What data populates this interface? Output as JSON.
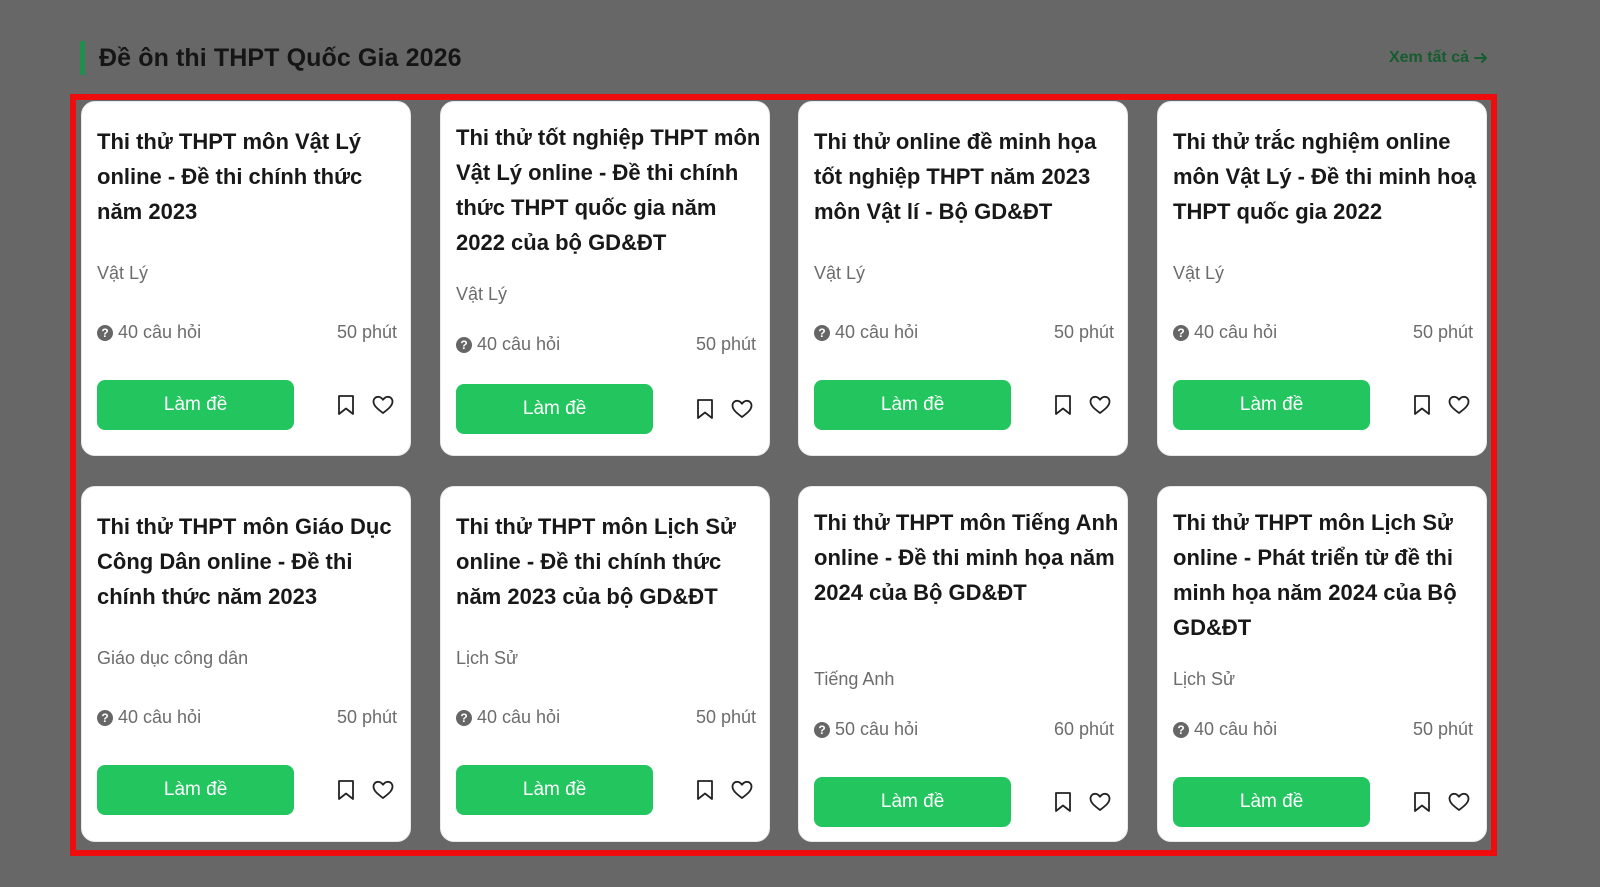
{
  "section": {
    "title": "Đề ôn thi THPT Quốc Gia 2026",
    "view_all": "Xem tất cả",
    "view_all_icon": "arrow-right-icon"
  },
  "colors": {
    "page_background": "#676767",
    "accent": "#1f8f4e",
    "button": "#22c55e",
    "highlight_frame": "#ee0c0c"
  },
  "cards": [
    {
      "title": "Thi thử THPT môn Vật Lý online - Đề thi chính thức năm 2023",
      "subject": "Vật Lý",
      "questions": "40 câu hỏi",
      "duration": "50 phút",
      "button": "Làm đề"
    },
    {
      "title": "Thi thử tốt nghiệp THPT môn Vật Lý online - Đề thi chính thức THPT quốc gia năm 2022 của bộ GD&ĐT",
      "subject": "Vật Lý",
      "questions": "40 câu hỏi",
      "duration": "50 phút",
      "button": "Làm đề"
    },
    {
      "title": "Thi thử online đề minh họa tốt nghiệp THPT năm 2023 môn Vật lí - Bộ GD&ĐT",
      "subject": "Vật Lý",
      "questions": "40 câu hỏi",
      "duration": "50 phút",
      "button": "Làm đề"
    },
    {
      "title": "Thi thử trắc nghiệm online môn Vật Lý - Đề thi minh hoạ THPT quốc gia 2022",
      "subject": "Vật Lý",
      "questions": "40 câu hỏi",
      "duration": "50 phút",
      "button": "Làm đề"
    },
    {
      "title": "Thi thử THPT môn Giáo Dục Công Dân online - Đề thi chính thức năm 2023",
      "subject": "Giáo dục công dân",
      "questions": "40 câu hỏi",
      "duration": "50 phút",
      "button": "Làm đề"
    },
    {
      "title": "Thi thử THPT môn Lịch Sử online - Đề thi chính thức năm 2023 của bộ GD&ĐT",
      "subject": "Lịch Sử",
      "questions": "40 câu hỏi",
      "duration": "50 phút",
      "button": "Làm đề"
    },
    {
      "title": "Thi thử THPT môn Tiếng Anh online - Đề thi minh họa năm 2024 của Bộ GD&ĐT",
      "subject": "Tiếng Anh",
      "questions": "50 câu hỏi",
      "duration": "60 phút",
      "button": "Làm đề"
    },
    {
      "title": "Thi thử THPT môn Lịch Sử online - Phát triển từ đề thi minh họa năm 2024 của Bộ GD&ĐT",
      "subject": "Lịch Sử",
      "questions": "40 câu hỏi",
      "duration": "50 phút",
      "button": "Làm đề"
    }
  ],
  "icons": {
    "question": "question-circle-icon",
    "bookmark": "bookmark-icon",
    "favorite": "heart-icon"
  }
}
